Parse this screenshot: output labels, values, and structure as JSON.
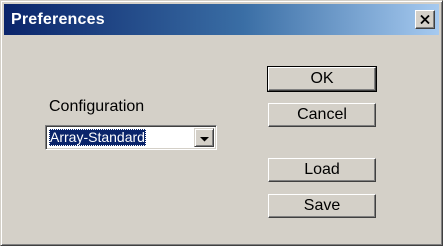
{
  "window": {
    "title": "Preferences"
  },
  "icons": {
    "close": "close-icon",
    "dropdown": "chevron-down-icon"
  },
  "colors": {
    "titlebar_start": "#0a246a",
    "titlebar_end": "#a6caf0",
    "face": "#d4d0c8",
    "selection": "#0a246a"
  },
  "configuration": {
    "label": "Configuration",
    "selected": "Array-Standard"
  },
  "buttons": {
    "ok": "OK",
    "cancel": "Cancel",
    "load": "Load",
    "save": "Save"
  }
}
